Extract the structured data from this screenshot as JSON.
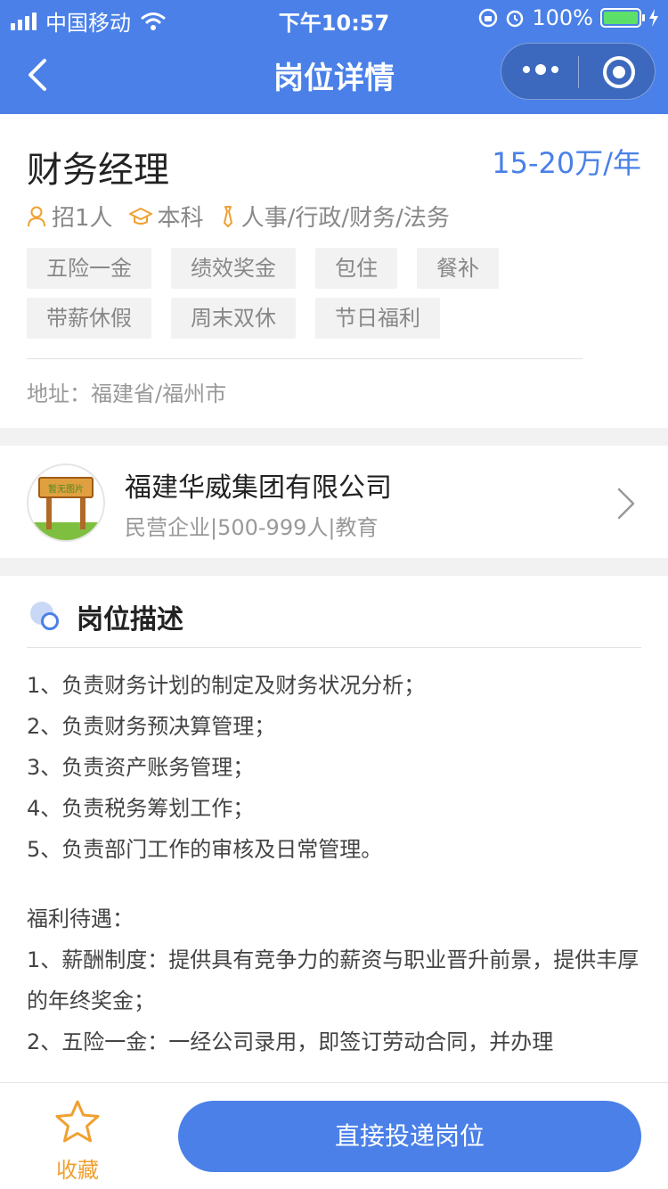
{
  "status_bar": {
    "carrier": "中国移动",
    "time": "下午10:57",
    "battery": "100%"
  },
  "nav": {
    "title": "岗位详情",
    "icons": [
      "back-arrow-icon",
      "more-dots-icon",
      "target-icon"
    ]
  },
  "job": {
    "title": "财务经理",
    "salary": "15-20万/年",
    "recruit": "招1人",
    "education": "本科",
    "category": "人事/行政/财务/法务",
    "tags": [
      "五险一金",
      "绩效奖金",
      "包住",
      "餐补",
      "带薪休假",
      "周末双休",
      "节日福利"
    ],
    "address_label": "地址：",
    "address": "福建省/福州市"
  },
  "company": {
    "name": "福建华威集团有限公司",
    "info": "民营企业|500-999人|教育",
    "logo_text": "暂无图片"
  },
  "description": {
    "heading": "岗位描述",
    "duties": [
      "1、负责财务计划的制定及财务状况分析；",
      "2、负责财务预决算管理；",
      "3、负责资产账务管理；",
      "4、负责税务筹划工作；",
      "5、负责部门工作的审核及日常管理。"
    ],
    "benefits_title": "福利待遇：",
    "benefits": [
      "1、薪酬制度：提供具有竞争力的薪资与职业晋升前景，提供丰厚的年终奖金；",
      "2、五险一金：一经公司录用，即签订劳动合同，并办理"
    ]
  },
  "bottom": {
    "favorite_label": "收藏",
    "apply_label": "直接投递岗位"
  },
  "colors": {
    "primary": "#4a80e8",
    "accent": "#f0a030"
  }
}
